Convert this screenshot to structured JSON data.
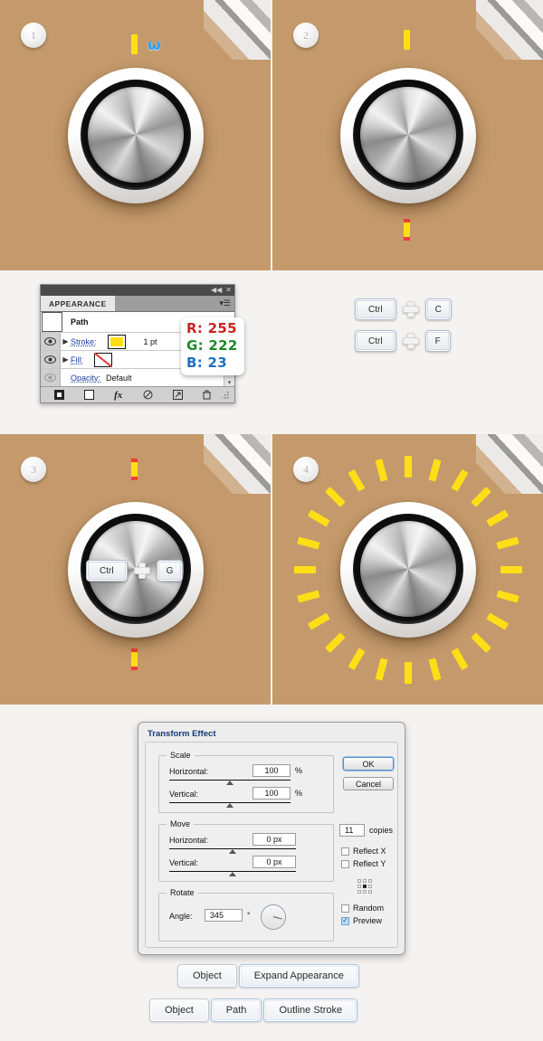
{
  "meta": {
    "background_color": "#f4f3f1",
    "panel_color": "#c49a6c",
    "tick_color": "#ffde17",
    "anchor_color": "#ef3e36"
  },
  "panels": [
    {
      "number": "1",
      "marks": [
        {
          "kind": "tick",
          "selected": false
        },
        {
          "kind": "omega",
          "glyph": "ω"
        }
      ]
    },
    {
      "number": "2",
      "marks": [
        {
          "kind": "tick",
          "selected": false
        },
        {
          "kind": "tick",
          "selected": true
        }
      ]
    },
    {
      "number": "3",
      "marks": [
        {
          "kind": "tick",
          "selected": true
        },
        {
          "kind": "tick",
          "selected": true
        }
      ]
    },
    {
      "number": "4",
      "marks": []
    }
  ],
  "radial_array": {
    "count": 24,
    "start_angle": 0,
    "step_angle": 15
  },
  "appearance_panel": {
    "tab_label": "APPEARANCE",
    "collapse_icon": "◀◀",
    "close_icon": "✕",
    "menu_icon": "panel-menu-icon",
    "object_name": "Path",
    "rows": [
      {
        "label": "Stroke:",
        "swatch": "#ffde17",
        "value": "1 pt",
        "has_arrow": true,
        "visible": true
      },
      {
        "label": "Fill:",
        "swatch": "none",
        "value": "",
        "has_arrow": true,
        "visible": true
      },
      {
        "label": "Opacity:",
        "swatch": "",
        "value": "Default",
        "has_arrow": false,
        "visible": true
      }
    ],
    "footer_icons": [
      "add-new-stroke-icon",
      "add-new-fill-icon",
      "add-new-effect-icon",
      "clear-appearance-icon",
      "duplicate-item-icon",
      "delete-item-icon"
    ]
  },
  "rgb_callout": {
    "r": "R: 255",
    "g": "G: 222",
    "b": "B: 23",
    "r_color": "#cc2222",
    "g_color": "#1e8a2e",
    "b_color": "#1f6fc4"
  },
  "shortcuts": [
    {
      "modifier": "Ctrl",
      "plus": "+",
      "key": "C"
    },
    {
      "modifier": "Ctrl",
      "plus": "+",
      "key": "F"
    },
    {
      "modifier": "Ctrl",
      "plus": "+",
      "key": "G"
    }
  ],
  "transform_dialog": {
    "title": "Transform Effect",
    "scale": {
      "legend": "Scale",
      "horizontal_label": "Horizontal:",
      "horizontal_value": "100",
      "horizontal_unit": "%",
      "vertical_label": "Vertical:",
      "vertical_value": "100",
      "vertical_unit": "%"
    },
    "move": {
      "legend": "Move",
      "horizontal_label": "Horizontal:",
      "horizontal_value": "0 px",
      "vertical_label": "Vertical:",
      "vertical_value": "0 px"
    },
    "rotate": {
      "legend": "Rotate",
      "angle_label": "Angle:",
      "angle_value": "345",
      "angle_unit": "°"
    },
    "ok_label": "OK",
    "cancel_label": "Cancel",
    "copies_value": "11",
    "copies_label": "copies",
    "reflect_x_label": "Reflect X",
    "reflect_x_checked": false,
    "reflect_y_label": "Reflect Y",
    "reflect_y_checked": false,
    "random_label": "Random",
    "random_checked": false,
    "preview_label": "Preview",
    "preview_checked": true,
    "reference_point": "center"
  },
  "menu_paths": [
    {
      "items": [
        {
          "label": "Object",
          "highlight": false
        },
        {
          "label": "Expand Appearance",
          "highlight": true
        }
      ]
    },
    {
      "items": [
        {
          "label": "Object",
          "highlight": false
        },
        {
          "label": "Path",
          "highlight": true
        },
        {
          "label": "Outline Stroke",
          "highlight": true
        }
      ]
    }
  ]
}
